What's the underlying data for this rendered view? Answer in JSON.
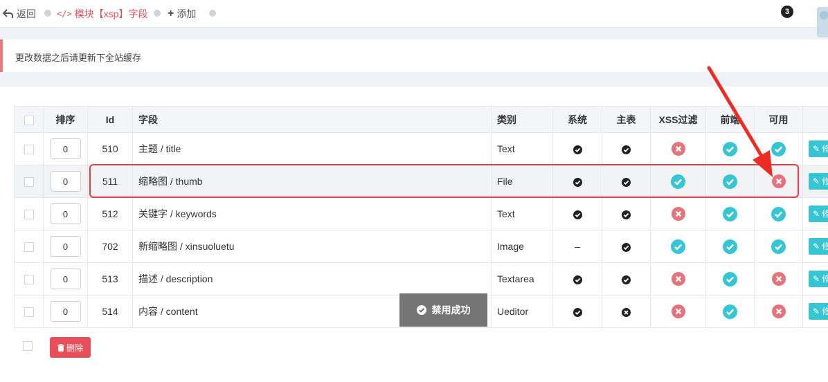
{
  "topbar": {
    "back_label": "返回",
    "module_label": "模块【xsp】字段",
    "add_label": "添加",
    "notification_count": "3"
  },
  "notice": {
    "text": "更改数据之后请更新下全站缓存"
  },
  "table": {
    "headers": {
      "sort": "排序",
      "id": "Id",
      "field": "字段",
      "type": "类别",
      "system": "系统",
      "main": "主表",
      "xss": "XSS过滤",
      "front": "前端",
      "enabled": "可用"
    },
    "rows": [
      {
        "sort": "0",
        "id": "510",
        "field": "主题 / title",
        "type": "Text"
      },
      {
        "sort": "0",
        "id": "511",
        "field": "缩略图 / thumb",
        "type": "File"
      },
      {
        "sort": "0",
        "id": "512",
        "field": "关键字 / keywords",
        "type": "Text"
      },
      {
        "sort": "0",
        "id": "702",
        "field": "新缩略图 / xinsuoluetu",
        "type": "Image"
      },
      {
        "sort": "0",
        "id": "513",
        "field": "描述 / description",
        "type": "Textarea"
      },
      {
        "sort": "0",
        "id": "514",
        "field": "内容 / content",
        "type": "Ueditor"
      }
    ],
    "edit_label": "修改",
    "dash": "–"
  },
  "toast": {
    "text": "禁用成功"
  },
  "footer": {
    "delete_label": "删除"
  },
  "colors": {
    "accent_red": "#e7505a",
    "accent_cyan": "#36c6d3",
    "highlight": "#e63b45"
  }
}
